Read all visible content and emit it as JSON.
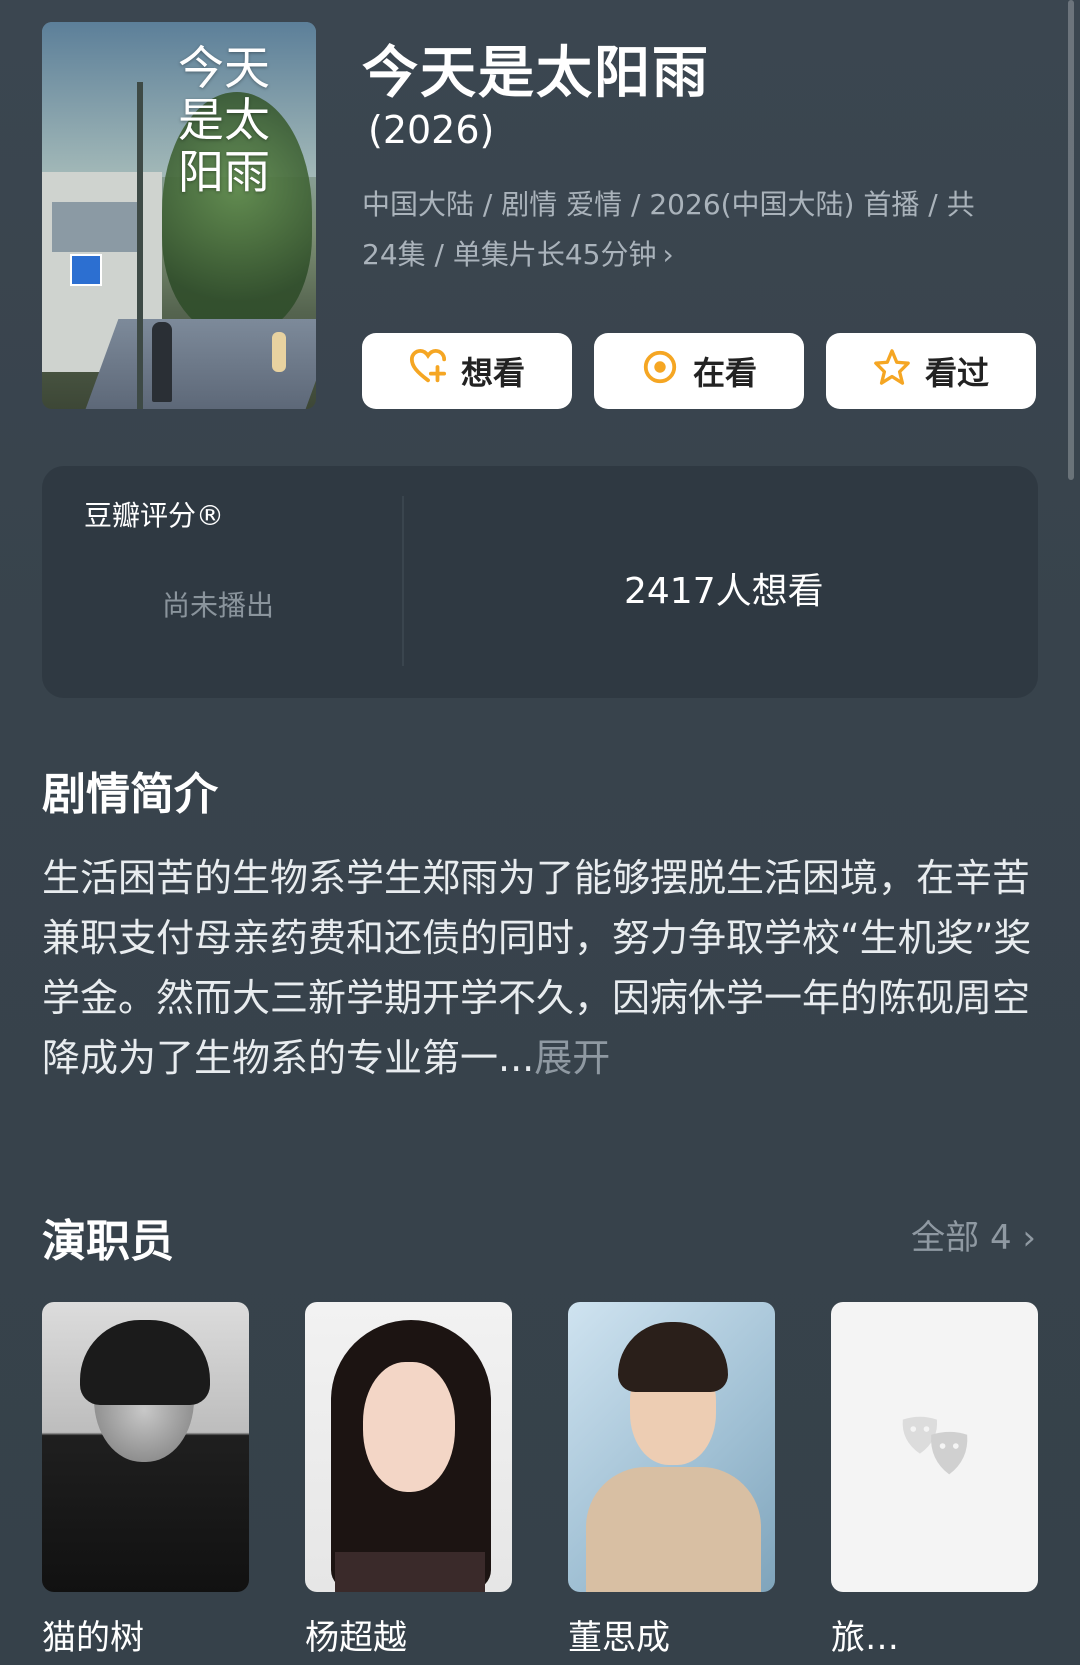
{
  "show": {
    "title": "今天是太阳雨",
    "year": "(2026)",
    "meta_line1": "中国大陆 / 剧情 爱情 / 2026(中国大陆) 首播 / 共",
    "meta_line2": "24集 / 单集片长45分钟",
    "meta_chevron": "›",
    "poster_title": "今天是太阳雨"
  },
  "actions": [
    {
      "label": "想看",
      "icon": "heart-plus-icon",
      "color": "#f5a623"
    },
    {
      "label": "在看",
      "icon": "target-icon",
      "color": "#f5a623"
    },
    {
      "label": "看过",
      "icon": "star-icon",
      "color": "#f5a623"
    }
  ],
  "rating": {
    "label": "豆瓣评分®",
    "status": "尚未播出",
    "wish_count": "2417人想看"
  },
  "synopsis": {
    "heading": "剧情简介",
    "text": "生活困苦的生物系学生郑雨为了能够摆脱生活困境，在辛苦兼职支付母亲药费和还债的同时，努力争取学校“生机奖”奖学金。然而大三新学期开学不久，因病休学一年的陈砚周空降成为了生物系的专业第一...",
    "expand": "展开"
  },
  "cast": {
    "heading": "演职员",
    "all_label": "全部 4 ›",
    "members": [
      {
        "name": "猫的树"
      },
      {
        "name": "杨超越"
      },
      {
        "name": "董思成"
      },
      {
        "name": "旅…"
      }
    ]
  }
}
